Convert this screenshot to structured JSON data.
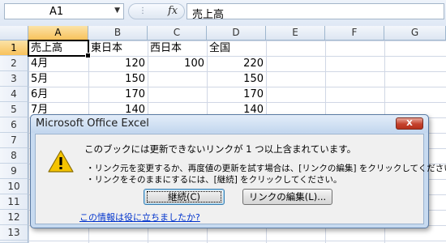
{
  "formula_bar": {
    "name_box": "A1",
    "fx_label": "fx",
    "content": "売上高"
  },
  "columns": [
    "A",
    "B",
    "C",
    "D",
    "E",
    "F",
    "G"
  ],
  "rows": [
    "1",
    "2",
    "3",
    "4",
    "5",
    "6",
    "7",
    "8",
    "9",
    "10",
    "11",
    "12",
    "13",
    "14"
  ],
  "cells": {
    "a1": "売上高",
    "b1": "東日本",
    "c1": "西日本",
    "d1": "全国",
    "a2": "4月",
    "b2": "120",
    "c2": "100",
    "d2": "220",
    "a3": "5月",
    "b3": "150",
    "d3": "150",
    "a4": "6月",
    "b4": "170",
    "d4": "170",
    "a5": "7月",
    "b5": "140",
    "d5": "140"
  },
  "dialog": {
    "title": "Microsoft Office Excel",
    "close_label": "X",
    "message": "このブックには更新できないリンクが 1 つ以上含まれています。",
    "note_line1": "・リンク元を変更するか、再度値の更新を試す場合は、[リンクの編集] をクリックしてください。",
    "note_line2": "・リンクをそのままにするには、[継続] をクリックしてください。",
    "continue_button": "継続(C)",
    "edit_links_button": "リンクの編集(L)...",
    "help_link": "この情報は役に立ちましたか?"
  }
}
